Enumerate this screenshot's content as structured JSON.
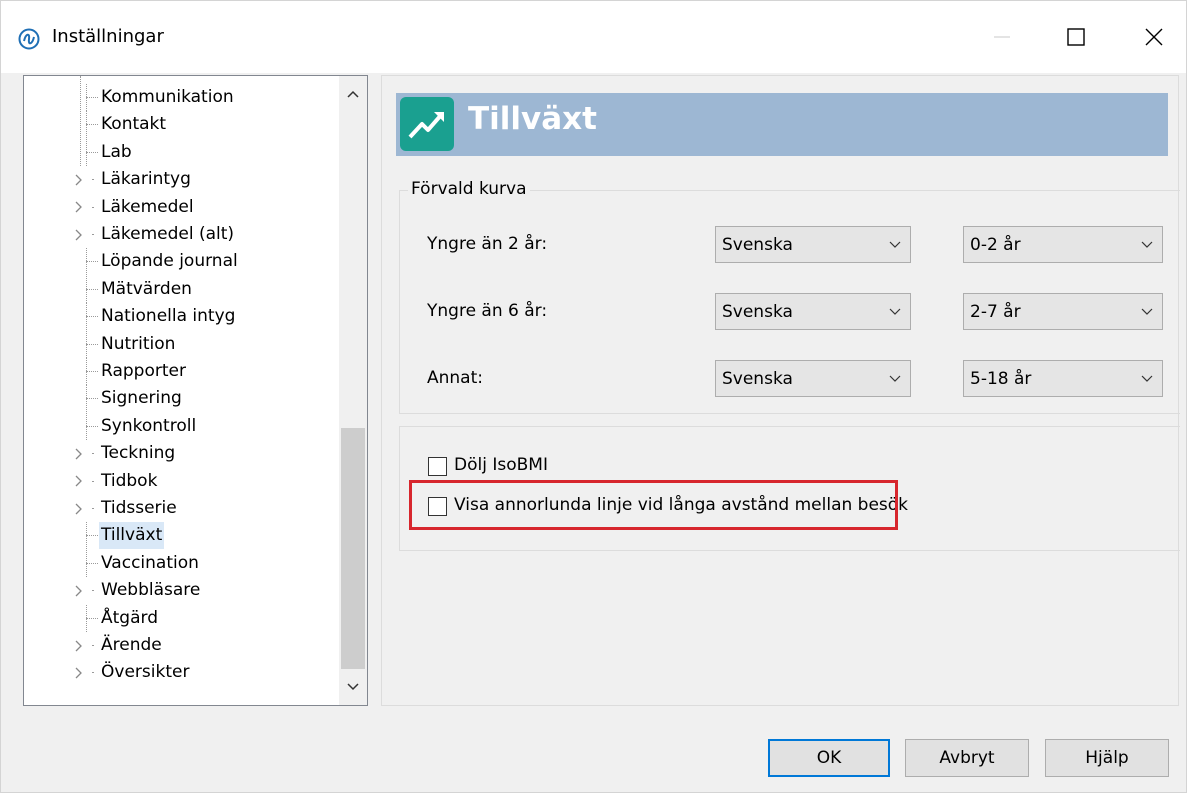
{
  "window": {
    "title": "Inställningar"
  },
  "tree": {
    "items": [
      {
        "label": "Kommunikation",
        "expandable": false
      },
      {
        "label": "Kontakt",
        "expandable": false
      },
      {
        "label": "Lab",
        "expandable": false
      },
      {
        "label": "Läkarintyg",
        "expandable": true
      },
      {
        "label": "Läkemedel",
        "expandable": true
      },
      {
        "label": "Läkemedel (alt)",
        "expandable": true
      },
      {
        "label": "Löpande journal",
        "expandable": false
      },
      {
        "label": "Mätvärden",
        "expandable": false
      },
      {
        "label": "Nationella intyg",
        "expandable": false
      },
      {
        "label": "Nutrition",
        "expandable": false
      },
      {
        "label": "Rapporter",
        "expandable": false
      },
      {
        "label": "Signering",
        "expandable": false
      },
      {
        "label": "Synkontroll",
        "expandable": false
      },
      {
        "label": "Teckning",
        "expandable": true
      },
      {
        "label": "Tidbok",
        "expandable": true
      },
      {
        "label": "Tidsserie",
        "expandable": true
      },
      {
        "label": "Tillväxt",
        "expandable": false,
        "selected": true
      },
      {
        "label": "Vaccination",
        "expandable": false
      },
      {
        "label": "Webbläsare",
        "expandable": true
      },
      {
        "label": "Åtgärd",
        "expandable": false
      },
      {
        "label": "Ärende",
        "expandable": true
      },
      {
        "label": "Översikter",
        "expandable": true
      }
    ]
  },
  "panel": {
    "title": "Tillväxt",
    "accent_color": "#9db7d3",
    "icon_color": "#1aa090",
    "group_title": "Förvald kurva",
    "rows": [
      {
        "label": "Yngre än 2 år:",
        "reference": "Svenska",
        "range": "0-2 år"
      },
      {
        "label": "Yngre än 6 år:",
        "reference": "Svenska",
        "range": "2-7 år"
      },
      {
        "label": "Annat:",
        "reference": "Svenska",
        "range": "5-18 år"
      }
    ],
    "checkboxes": [
      {
        "label": "Dölj IsoBMI",
        "checked": false
      },
      {
        "label": "Visa annorlunda linje vid långa avstånd mellan besök",
        "checked": false
      }
    ],
    "highlight_color": "#d7262d"
  },
  "buttons": {
    "ok": "OK",
    "cancel": "Avbryt",
    "help": "Hjälp"
  }
}
